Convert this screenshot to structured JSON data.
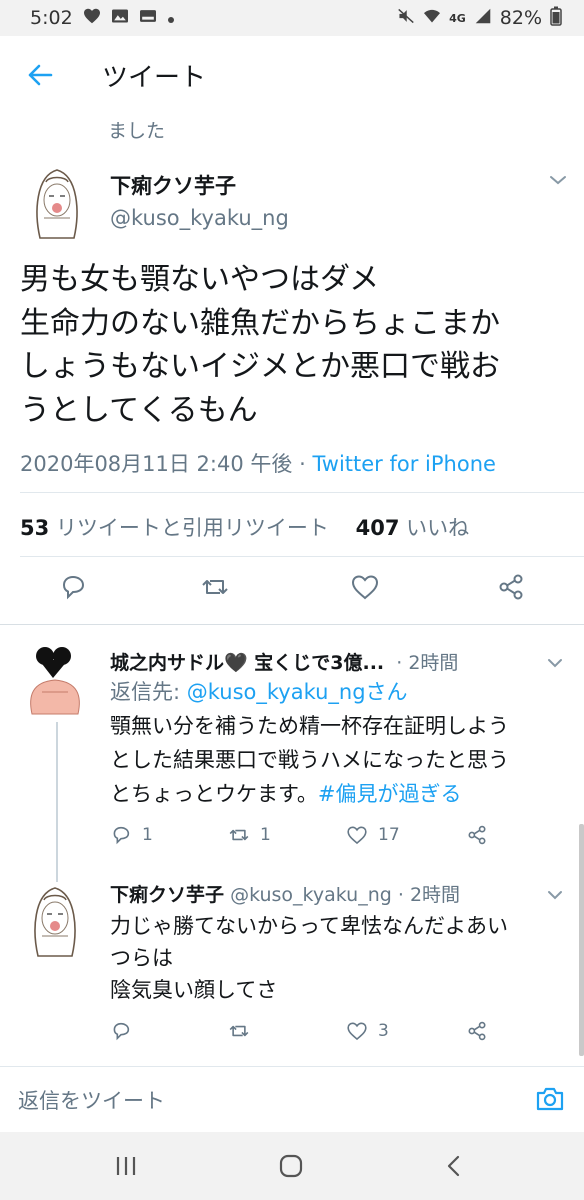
{
  "status_bar": {
    "time": "5:02",
    "network": "4G",
    "battery": "82%"
  },
  "header": {
    "title": "ツイート"
  },
  "faint_text": "ました",
  "main_tweet": {
    "name": "下痢クソ芋子",
    "handle": "@kuso_kyaku_ng",
    "text_lines": [
      "男も女も顎ないやつはダメ",
      "生命力のない雑魚だからちょこまか",
      "しょうもないイジメとか悪口で戦お",
      "うとしてくるもん"
    ],
    "timestamp": "2020年08月11日 2:40 午後 ·",
    "source": "Twitter for iPhone",
    "retweet_count": "53",
    "retweet_label": "リツイートと引用リツイート",
    "like_count": "407",
    "like_label": "いいね"
  },
  "replies": [
    {
      "name": "城之内サドル🖤 宝くじで3億...",
      "time": "· 2時間",
      "reply_to_prefix": "返信先: ",
      "reply_to_handle": "@kuso_kyaku_ngさん",
      "text_lines": [
        "顎無い分を補うため精一杯存在証明しよう",
        "とした結果悪口で戦うハメになったと思う",
        "とちょっとウケます。"
      ],
      "hashtag": "#偏見が過ぎる",
      "reply_count": "1",
      "retweet_count": "1",
      "like_count": "17"
    },
    {
      "name": "下痢クソ芋子",
      "meta": "@kuso_kyaku_ng · 2時間",
      "text_lines": [
        "力じゃ勝てないからって卑怯なんだよあい",
        "つらは",
        "陰気臭い顔してさ"
      ],
      "reply_count": "",
      "retweet_count": "",
      "like_count": "3"
    }
  ],
  "compose": {
    "placeholder": "返信をツイート"
  },
  "colors": {
    "accent": "#1da1f2",
    "secondary_text": "#657786",
    "primary_text": "#14171a"
  }
}
